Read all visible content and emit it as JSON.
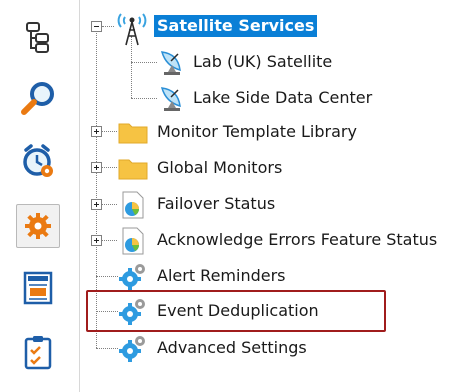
{
  "toolbar": {
    "buttons": [
      {
        "name": "tree-view"
      },
      {
        "name": "search-monitor"
      },
      {
        "name": "alarm-clock"
      },
      {
        "name": "settings",
        "active": true
      },
      {
        "name": "news-report"
      },
      {
        "name": "checklist"
      }
    ]
  },
  "tree": {
    "root": {
      "label": "Satellite Services"
    },
    "children_of_root": [
      {
        "label": "Lab (UK) Satellite"
      },
      {
        "label": "Lake Side Data Center"
      }
    ],
    "items": [
      {
        "label": "Monitor Template Library"
      },
      {
        "label": "Global Monitors"
      },
      {
        "label": "Failover Status"
      },
      {
        "label": "Acknowledge Errors Feature Status"
      },
      {
        "label": "Alert Reminders"
      },
      {
        "label": "Event Deduplication"
      },
      {
        "label": "Advanced Settings"
      }
    ]
  },
  "colors": {
    "selection": "#0a7fd6",
    "highlight_border": "#a01c1c",
    "folder": "#f6c343",
    "gear": "#2e9be0"
  }
}
